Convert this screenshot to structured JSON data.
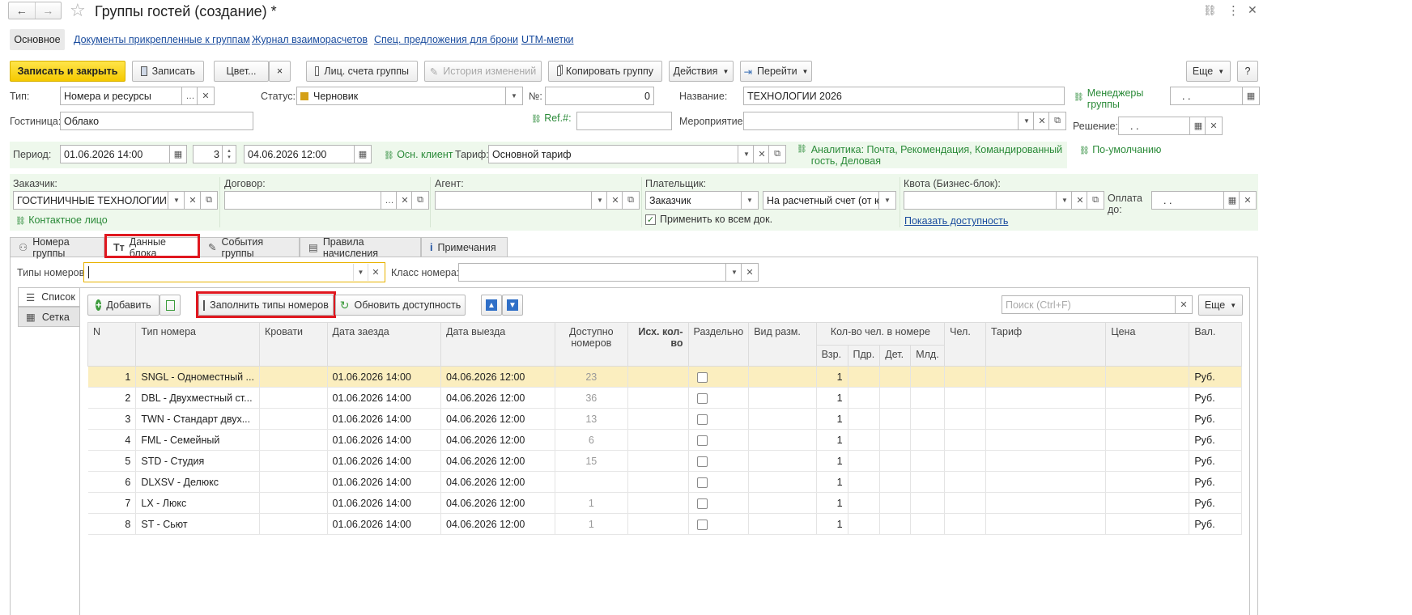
{
  "window": {
    "title": "Группы гостей (создание) *",
    "back_icon": "←",
    "forward_icon": "→",
    "star_icon": "☆",
    "link_icon": "🔗",
    "more_icon": "⋮",
    "close_icon": "✕"
  },
  "nav_tabs": [
    "Основное",
    "Документы прикрепленные к группам",
    "Журнал взаиморасчетов",
    "Спец. предложения для брони",
    "UTM-метки"
  ],
  "toolbar": {
    "save_close": "Записать и закрыть",
    "save": "Записать",
    "color": "Цвет...",
    "color_clear": "×",
    "accounts": "Лиц. счета группы",
    "history": "История изменений",
    "copy": "Копировать группу",
    "actions": "Действия",
    "goto": "Перейти",
    "more": "Еще",
    "help": "?"
  },
  "form": {
    "type_label": "Тип:",
    "type_value": "Номера и ресурсы",
    "hotel_label": "Гостиница:",
    "hotel_value": "Облако",
    "status_label": "Статус:",
    "status_value": "Черновик",
    "num_label": "№:",
    "num_value": "0",
    "ref_label": "Ref.#:",
    "ref_value": "",
    "name_label": "Название:",
    "name_value": "ТЕХНОЛОГИИ 2026",
    "event_label": "Мероприятие:",
    "event_value": "",
    "managers_label": "Менеджеры группы",
    "managers_value": ". .",
    "decision_label": "Решение:",
    "decision_value": ". ."
  },
  "period": {
    "label": "Период:",
    "from": "01.06.2026 14:00",
    "nights": "3",
    "to": "04.06.2026 12:00",
    "client_link": "Осн. клиент",
    "tariff_label": "Тариф:",
    "tariff_value": "Основной тариф",
    "analytics": "Аналитика: Почта, Рекомендация, Командированный гость, Деловая",
    "default_link": "По-умолчанию"
  },
  "parties": {
    "customer_label": "Заказчик:",
    "customer_value": "ГОСТИНИЧНЫЕ ТЕХНОЛОГИИ",
    "contract_label": "Договор:",
    "contract_value": "",
    "agent_label": "Агент:",
    "agent_value": "",
    "payer_label": "Плательщик:",
    "payer_value": "Заказчик",
    "payer_method": "На расчетный счет (от юр",
    "quota_label": "Квота (Бизнес-блок):",
    "quota_value": "",
    "pay_until_label": "Оплата до:",
    "pay_until_value": ". .",
    "contact_link": "Контактное лицо",
    "apply_all": "Применить ко всем док.",
    "show_availability": "Показать доступность"
  },
  "tabs": [
    "Номера группы",
    "Данные блока",
    "События группы",
    "Правила начисления",
    "Примечания"
  ],
  "filters": {
    "room_types_label": "Типы номеров:",
    "room_types_value": "",
    "room_class_label": "Класс номера:",
    "room_class_value": ""
  },
  "view_switch": [
    "Список",
    "Сетка"
  ],
  "grid_toolbar": {
    "add": "Добавить",
    "fill_types": "Заполнить типы номеров",
    "refresh": "Обновить доступность",
    "search_placeholder": "Поиск (Ctrl+F)",
    "more": "Еще"
  },
  "table": {
    "headers": {
      "n": "N",
      "room_type": "Тип номера",
      "beds": "Кровати",
      "checkin": "Дата заезда",
      "checkout": "Дата выезда",
      "available": "Доступно номеров",
      "initial": "Исх. кол-во",
      "separate": "Раздельно",
      "placement": "Вид разм.",
      "guests": "Кол-во чел. в номере",
      "adult": "Взр.",
      "extra": "Пдр.",
      "child": "Дет.",
      "infant": "Млд.",
      "people": "Чел.",
      "tariff": "Тариф",
      "price": "Цена",
      "currency": "Вал."
    },
    "rows": [
      {
        "n": "1",
        "type": "SNGL - Одноместный ...",
        "checkin": "01.06.2026 14:00",
        "checkout": "04.06.2026 12:00",
        "avail": "23",
        "adult": "1",
        "cur": "Руб."
      },
      {
        "n": "2",
        "type": "DBL - Двухместный ст...",
        "checkin": "01.06.2026 14:00",
        "checkout": "04.06.2026 12:00",
        "avail": "36",
        "adult": "1",
        "cur": "Руб."
      },
      {
        "n": "3",
        "type": "TWN - Стандарт двух...",
        "checkin": "01.06.2026 14:00",
        "checkout": "04.06.2026 12:00",
        "avail": "13",
        "adult": "1",
        "cur": "Руб."
      },
      {
        "n": "4",
        "type": "FML - Семейный",
        "checkin": "01.06.2026 14:00",
        "checkout": "04.06.2026 12:00",
        "avail": "6",
        "adult": "1",
        "cur": "Руб."
      },
      {
        "n": "5",
        "type": "STD - Студия",
        "checkin": "01.06.2026 14:00",
        "checkout": "04.06.2026 12:00",
        "avail": "15",
        "adult": "1",
        "cur": "Руб."
      },
      {
        "n": "6",
        "type": "DLXSV - Делюкс",
        "checkin": "01.06.2026 14:00",
        "checkout": "04.06.2026 12:00",
        "avail": "",
        "adult": "1",
        "cur": "Руб."
      },
      {
        "n": "7",
        "type": "LX - Люкс",
        "checkin": "01.06.2026 14:00",
        "checkout": "04.06.2026 12:00",
        "avail": "1",
        "adult": "1",
        "cur": "Руб."
      },
      {
        "n": "8",
        "type": "ST - Сьют",
        "checkin": "01.06.2026 14:00",
        "checkout": "04.06.2026 12:00",
        "avail": "1",
        "adult": "1",
        "cur": "Руб."
      }
    ]
  },
  "colors": {
    "accent_yellow": "#f5c900",
    "link_blue": "#1a4c9e",
    "green_text": "#2a8a38",
    "highlight_red": "#e0171f",
    "selected_row": "#fbeebf"
  }
}
